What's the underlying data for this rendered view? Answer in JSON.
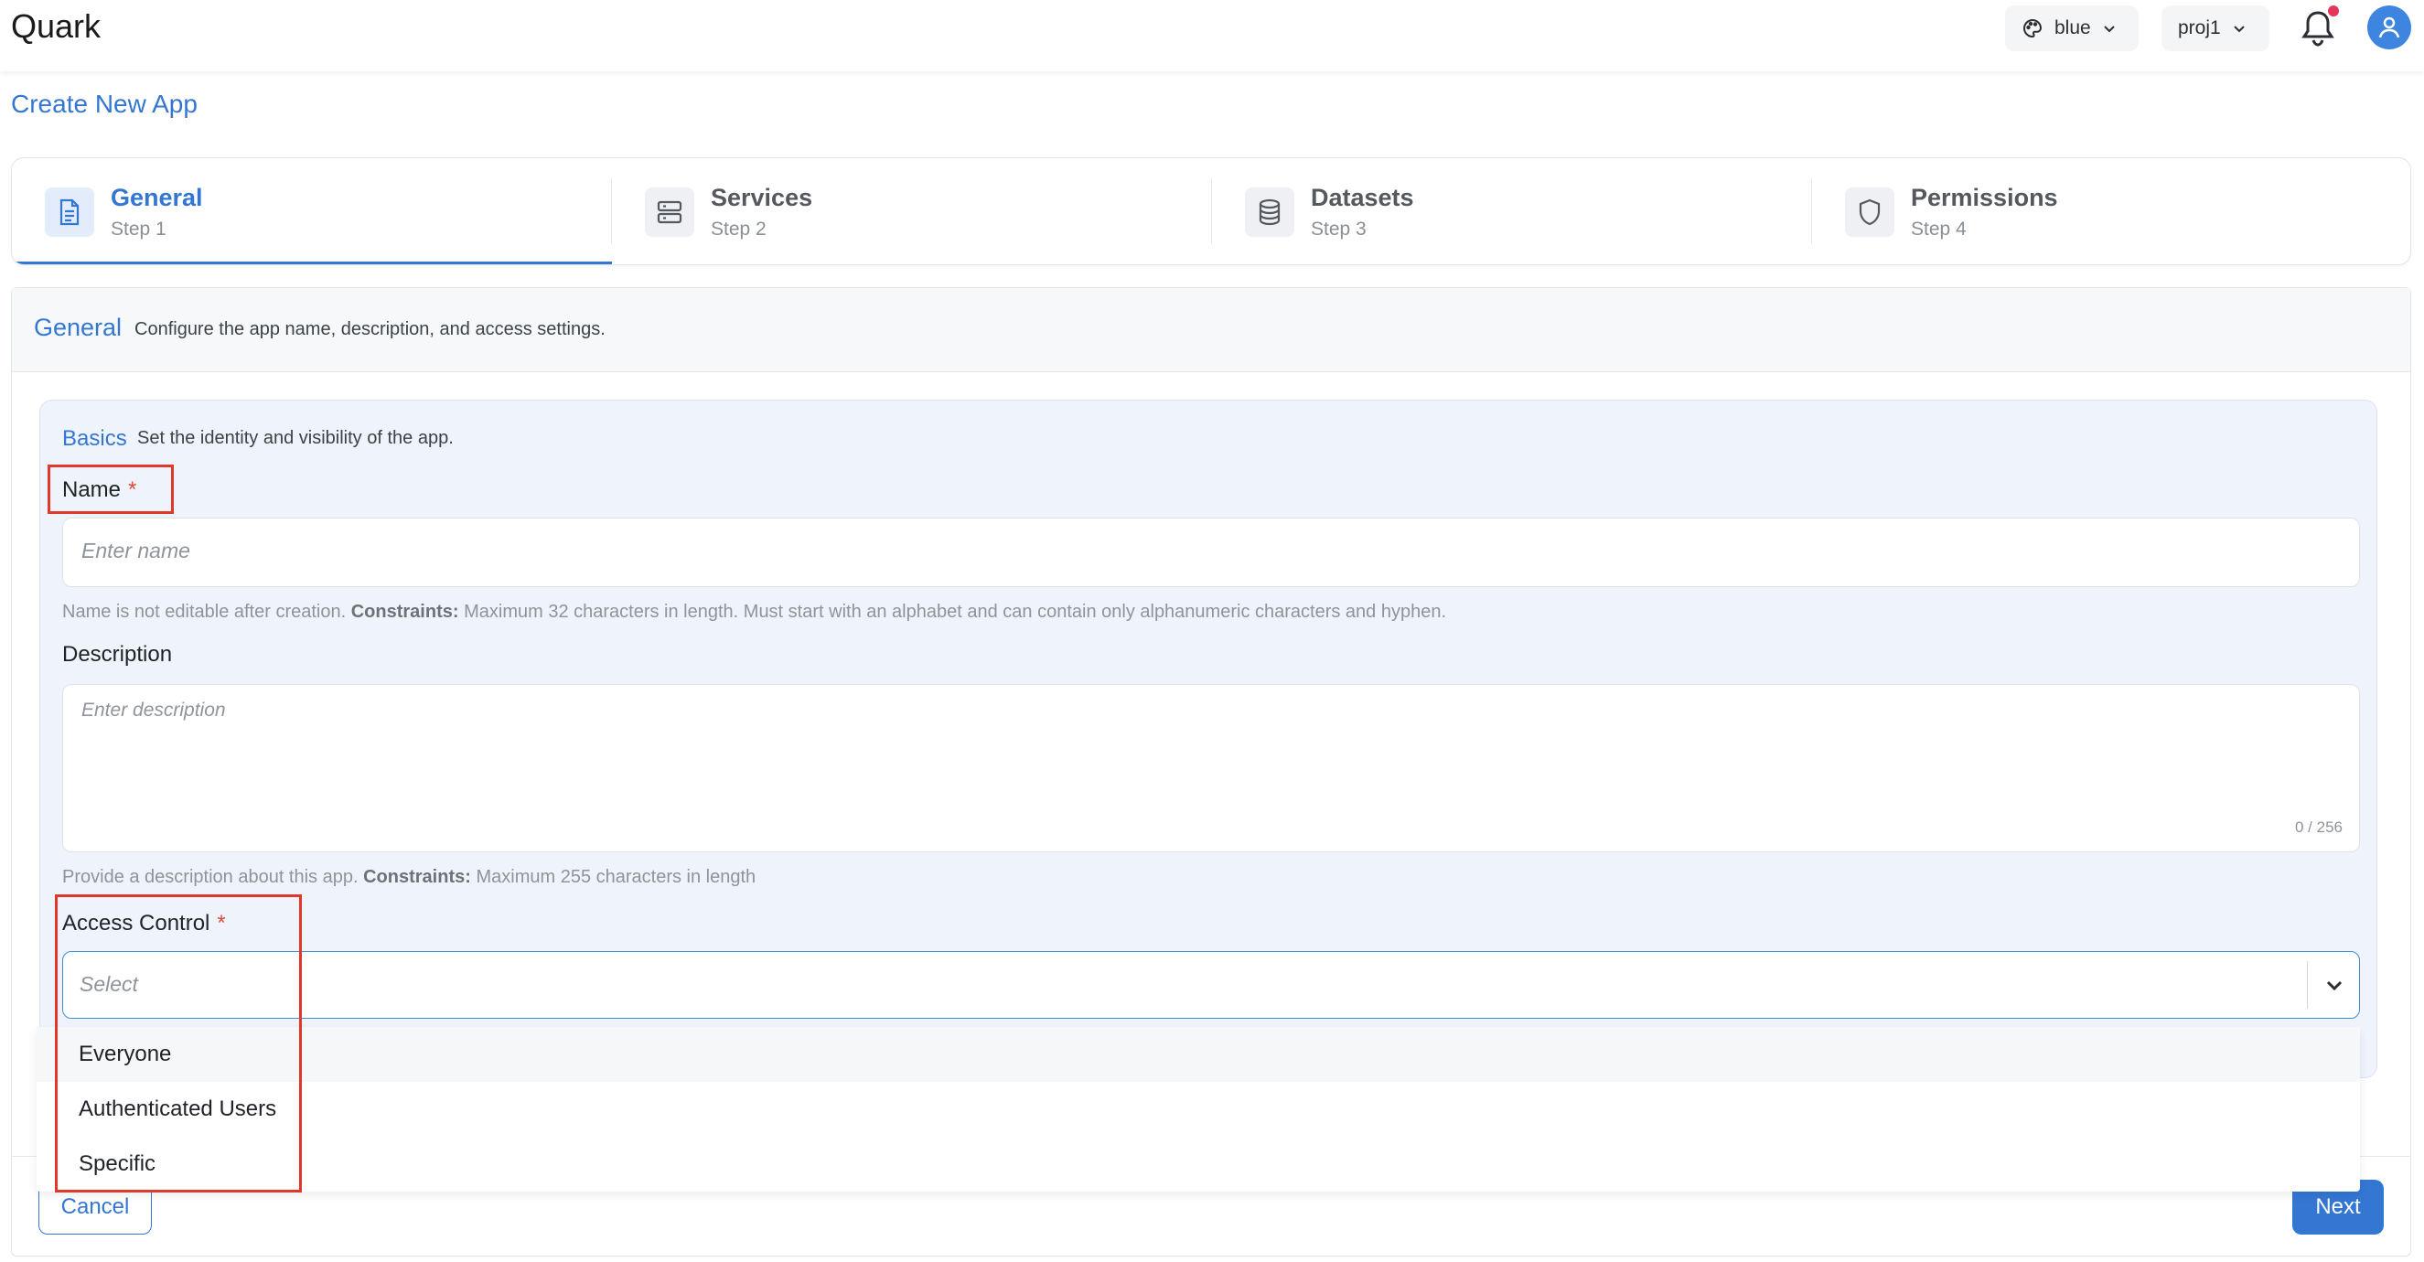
{
  "app": {
    "brand": "Quark"
  },
  "header": {
    "theme_label": "blue",
    "project_label": "proj1",
    "has_notification": true
  },
  "page": {
    "title": "Create New App"
  },
  "steps": [
    {
      "title": "General",
      "subtitle": "Step 1",
      "icon": "document-icon",
      "active": true
    },
    {
      "title": "Services",
      "subtitle": "Step 2",
      "icon": "server-icon",
      "active": false
    },
    {
      "title": "Datasets",
      "subtitle": "Step 3",
      "icon": "database-icon",
      "active": false
    },
    {
      "title": "Permissions",
      "subtitle": "Step 4",
      "icon": "shield-icon",
      "active": false
    }
  ],
  "general": {
    "heading": "General",
    "description": "Configure the app name, description, and access settings."
  },
  "basics": {
    "heading": "Basics",
    "description": "Set the identity and visibility of the app."
  },
  "form": {
    "name": {
      "label": "Name",
      "required_mark": "*",
      "placeholder": "Enter name",
      "hint_prefix": "Name is not editable after creation.",
      "hint_constraints_label": "Constraints:",
      "hint_constraints": "Maximum 32 characters in length. Must start with an alphabet and can contain only alphanumeric characters and hyphen."
    },
    "description": {
      "label": "Description",
      "placeholder": "Enter description",
      "counter": "0 / 256",
      "hint_prefix": "Provide a description about this app.",
      "hint_constraints_label": "Constraints:",
      "hint_constraints": "Maximum 255 characters in length"
    },
    "access_control": {
      "label": "Access Control",
      "required_mark": "*",
      "placeholder": "Select",
      "options": [
        "Everyone",
        "Authenticated Users",
        "Specific"
      ]
    }
  },
  "footer": {
    "cancel_label": "Cancel",
    "next_label": "Next"
  },
  "colors": {
    "accent": "#3477d3",
    "required": "#e14a3b",
    "highlight_box": "#e0392b",
    "notification_dot": "#e5355a"
  }
}
